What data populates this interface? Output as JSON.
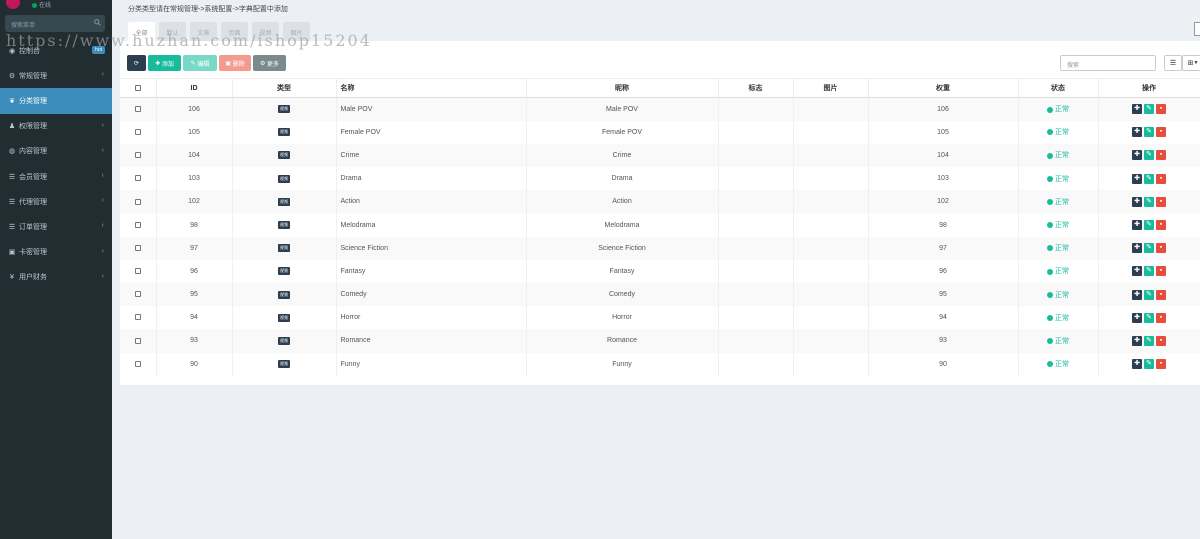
{
  "sidebar": {
    "status_text": "在线",
    "search_placeholder": "搜索菜单",
    "items": [
      {
        "label": "控制台",
        "icon": "dashboard-icon",
        "glyph": "◉",
        "badge": "hot",
        "chev": ""
      },
      {
        "label": "常规管理",
        "icon": "cogs-icon",
        "glyph": "⚙",
        "badge": "",
        "chev": "‹"
      },
      {
        "label": "分类管理",
        "icon": "leaf-icon",
        "glyph": "❦",
        "badge": "",
        "chev": ""
      },
      {
        "label": "权限管理",
        "icon": "group-icon",
        "glyph": "♟",
        "badge": "",
        "chev": "‹"
      },
      {
        "label": "内容管理",
        "icon": "globe-icon",
        "glyph": "◍",
        "badge": "",
        "chev": "‹"
      },
      {
        "label": "会员管理",
        "icon": "list-icon",
        "glyph": "☰",
        "badge": "",
        "chev": "‹"
      },
      {
        "label": "代理管理",
        "icon": "list-icon",
        "glyph": "☰",
        "badge": "",
        "chev": "‹"
      },
      {
        "label": "订单管理",
        "icon": "list-icon",
        "glyph": "☰",
        "badge": "",
        "chev": "‹"
      },
      {
        "label": "卡密管理",
        "icon": "image-icon",
        "glyph": "▣",
        "badge": "",
        "chev": "‹"
      },
      {
        "label": "用户财务",
        "icon": "yen-icon",
        "glyph": "¥",
        "badge": "",
        "chev": "‹"
      }
    ]
  },
  "breadcrumb": "分类类型请在常规管理->系统配置->字典配置中添加",
  "tabs": [
    "全部",
    "默认",
    "文章",
    "页面",
    "视频",
    "图片"
  ],
  "toolbar": {
    "add_label": "添加",
    "edit_label": "编辑",
    "delete_label": "删除",
    "more_label": "更多",
    "search_placeholder": "搜索"
  },
  "table": {
    "headers": [
      "ID",
      "类型",
      "名称",
      "昵称",
      "标志",
      "图片",
      "权重",
      "状态",
      "操作"
    ],
    "rows": [
      {
        "id": "106",
        "type": "视频",
        "name": "Male POV",
        "nick": "Male POV",
        "weight": "106",
        "status": "正常"
      },
      {
        "id": "105",
        "type": "视频",
        "name": "Female POV",
        "nick": "Female POV",
        "weight": "105",
        "status": "正常"
      },
      {
        "id": "104",
        "type": "视频",
        "name": "Crime",
        "nick": "Crime",
        "weight": "104",
        "status": "正常"
      },
      {
        "id": "103",
        "type": "视频",
        "name": "Drama",
        "nick": "Drama",
        "weight": "103",
        "status": "正常"
      },
      {
        "id": "102",
        "type": "视频",
        "name": "Action",
        "nick": "Action",
        "weight": "102",
        "status": "正常"
      },
      {
        "id": "98",
        "type": "视频",
        "name": "Melodrama",
        "nick": "Melodrama",
        "weight": "98",
        "status": "正常"
      },
      {
        "id": "97",
        "type": "视频",
        "name": "Science Fiction",
        "nick": "Science Fiction",
        "weight": "97",
        "status": "正常"
      },
      {
        "id": "96",
        "type": "视频",
        "name": "Fantasy",
        "nick": "Fantasy",
        "weight": "96",
        "status": "正常"
      },
      {
        "id": "95",
        "type": "视频",
        "name": "Comedy",
        "nick": "Comedy",
        "weight": "95",
        "status": "正常"
      },
      {
        "id": "94",
        "type": "视频",
        "name": "Horror",
        "nick": "Horror",
        "weight": "94",
        "status": "正常"
      },
      {
        "id": "93",
        "type": "视频",
        "name": "Romance",
        "nick": "Romance",
        "weight": "93",
        "status": "正常"
      },
      {
        "id": "90",
        "type": "视频",
        "name": "Funny",
        "nick": "Funny",
        "weight": "90",
        "status": "正常"
      }
    ]
  },
  "watermark": "https://www.huzhan.com/ishop15204",
  "colors": {
    "sidebar": "#222d32",
    "active": "#3c8dbc",
    "success": "#18bc9c",
    "danger": "#e74c3c",
    "dark": "#2c3e50"
  }
}
